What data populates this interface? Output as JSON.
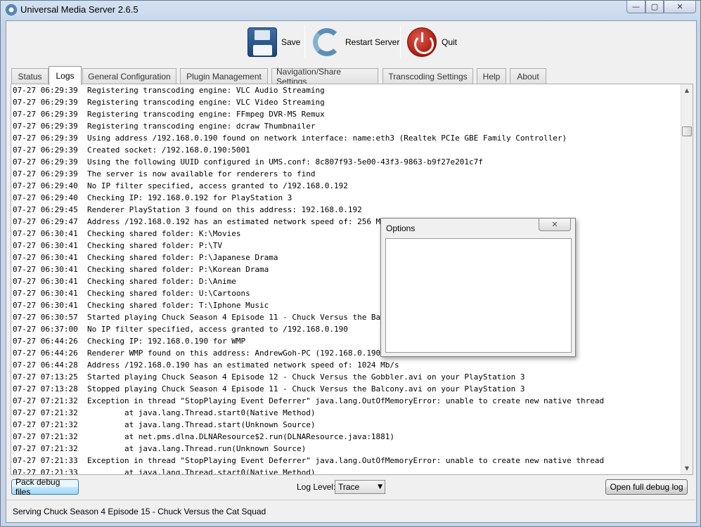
{
  "window": {
    "title": "Universal Media Server 2.6.5",
    "minimize_glyph": "—",
    "maximize_glyph": "▢",
    "close_glyph": "✕"
  },
  "toolbar": {
    "save_label": "Save",
    "restart_label": "Restart Server",
    "quit_label": "Quit",
    "save_icon": "floppy-disk-icon",
    "restart_icon": "refresh-icon",
    "quit_icon": "power-icon"
  },
  "tabs": [
    {
      "label": "Status",
      "active": false
    },
    {
      "label": "Logs",
      "active": true
    },
    {
      "label": "General Configuration",
      "active": false
    },
    {
      "label": "Plugin Management",
      "active": false
    },
    {
      "label": "Navigation/Share Settings",
      "active": false
    },
    {
      "label": "Transcoding Settings",
      "active": false
    },
    {
      "label": "Help",
      "active": false
    },
    {
      "label": "About",
      "active": false
    }
  ],
  "log": {
    "lines": [
      "07-27 06:29:39  Registering transcoding engine: VLC Audio Streaming",
      "07-27 06:29:39  Registering transcoding engine: VLC Video Streaming",
      "07-27 06:29:39  Registering transcoding engine: FFmpeg DVR-MS Remux",
      "07-27 06:29:39  Registering transcoding engine: dcraw Thumbnailer",
      "07-27 06:29:39  Using address /192.168.0.190 found on network interface: name:eth3 (Realtek PCIe GBE Family Controller)",
      "07-27 06:29:39  Created socket: /192.168.0.190:5001",
      "07-27 06:29:39  Using the following UUID configured in UMS.conf: 8c807f93-5e00-43f3-9863-b9f27e201c7f",
      "07-27 06:29:39  The server is now available for renderers to find",
      "07-27 06:29:40  No IP filter specified, access granted to /192.168.0.192",
      "07-27 06:29:40  Checking IP: 192.168.0.192 for PlayStation 3",
      "07-27 06:29:45  Renderer PlayStation 3 found on this address: 192.168.0.192",
      "07-27 06:29:47  Address /192.168.0.192 has an estimated network speed of: 256 Mb/s",
      "07-27 06:30:41  Checking shared folder: K:\\Movies",
      "07-27 06:30:41  Checking shared folder: P:\\TV",
      "07-27 06:30:41  Checking shared folder: P:\\Japanese Drama",
      "07-27 06:30:41  Checking shared folder: P:\\Korean Drama",
      "07-27 06:30:41  Checking shared folder: D:\\Anime",
      "07-27 06:30:41  Checking shared folder: U:\\Cartoons",
      "07-27 06:30:41  Checking shared folder: T:\\Iphone Music",
      "07-27 06:30:57  Started playing Chuck Season 4 Episode 11 - Chuck Versus the Balcony.avi on your PlayStation 3",
      "07-27 06:37:00  No IP filter specified, access granted to /192.168.0.190",
      "07-27 06:44:26  Checking IP: 192.168.0.190 for WMP",
      "07-27 06:44:26  Renderer WMP found on this address: AndrewGoh-PC (192.168.0.190)",
      "07-27 06:44:28  Address /192.168.0.190 has an estimated network speed of: 1024 Mb/s",
      "07-27 07:13:25  Started playing Chuck Season 4 Episode 12 - Chuck Versus the Gobbler.avi on your PlayStation 3",
      "07-27 07:13:28  Stopped playing Chuck Season 4 Episode 11 - Chuck Versus the Balcony.avi on your PlayStation 3",
      "07-27 07:21:32  Exception in thread \"StopPlaying Event Deferrer\" java.lang.OutOfMemoryError: unable to create new native thread",
      "07-27 07:21:32          at java.lang.Thread.start0(Native Method)",
      "07-27 07:21:32          at java.lang.Thread.start(Unknown Source)",
      "07-27 07:21:32          at net.pms.dlna.DLNAResource$2.run(DLNAResource.java:1881)",
      "07-27 07:21:32          at java.lang.Thread.run(Unknown Source)",
      "07-27 07:21:33  Exception in thread \"StopPlaying Event Deferrer\" java.lang.OutOfMemoryError: unable to create new native thread",
      "07-27 07:21:33          at java.lang.Thread.start0(Native Method)"
    ],
    "scroll_up_glyph": "▲",
    "scroll_down_glyph": "▼"
  },
  "footer": {
    "pack_debug_label": "Pack debug files",
    "log_level_label": "Log Level:",
    "log_level_value": "Trace",
    "select_arrow": "▼",
    "open_debug_label": "Open full debug log"
  },
  "status": {
    "text": "Serving Chuck Season 4 Episode 15 - Chuck Versus the Cat Squad"
  },
  "dialog": {
    "title": "Options",
    "close_glyph": "✕"
  }
}
